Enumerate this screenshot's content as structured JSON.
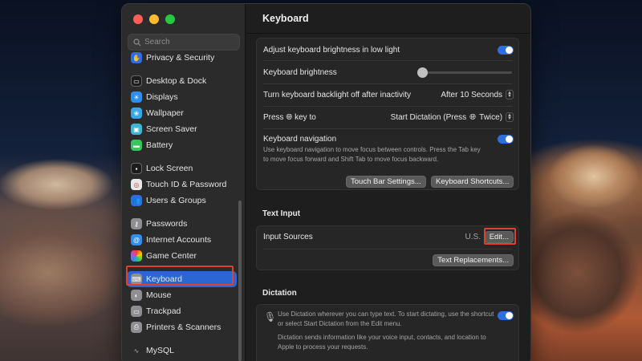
{
  "sidebar": {
    "search_placeholder": "Search",
    "items": [
      {
        "label": "Privacy & Security",
        "icon": "hand-icon",
        "color": "#2f6ee0"
      },
      {
        "label": "Desktop & Dock",
        "icon": "dock-icon",
        "color": "#1c1c1c"
      },
      {
        "label": "Displays",
        "icon": "display-icon",
        "color": "#2f8ff0"
      },
      {
        "label": "Wallpaper",
        "icon": "wallpaper-icon",
        "color": "#36a7e8"
      },
      {
        "label": "Screen Saver",
        "icon": "screensaver-icon",
        "color": "#3db7d8"
      },
      {
        "label": "Battery",
        "icon": "battery-icon",
        "color": "#34c759"
      },
      {
        "label": "Lock Screen",
        "icon": "lock-icon",
        "color": "#1c1c1c"
      },
      {
        "label": "Touch ID & Password",
        "icon": "fingerprint-icon",
        "color": "#e8e8e8"
      },
      {
        "label": "Users & Groups",
        "icon": "users-icon",
        "color": "#2f6ee0"
      },
      {
        "label": "Passwords",
        "icon": "key-icon",
        "color": "#8e8e93"
      },
      {
        "label": "Internet Accounts",
        "icon": "at-icon",
        "color": "#2f8ff0"
      },
      {
        "label": "Game Center",
        "icon": "gamecenter-icon",
        "color": "#e8e8e8"
      },
      {
        "label": "Keyboard",
        "icon": "keyboard-icon",
        "color": "#8e8e93"
      },
      {
        "label": "Mouse",
        "icon": "mouse-icon",
        "color": "#8e8e93"
      },
      {
        "label": "Trackpad",
        "icon": "trackpad-icon",
        "color": "#8e8e93"
      },
      {
        "label": "Printers & Scanners",
        "icon": "printer-icon",
        "color": "#8e8e93"
      },
      {
        "label": "MySQL",
        "icon": "mysql-icon",
        "color": "#2b2b2b"
      }
    ]
  },
  "main": {
    "title": "Keyboard",
    "brightness_low_light_label": "Adjust keyboard brightness in low light",
    "keyboard_brightness_label": "Keyboard brightness",
    "keyboard_brightness_level": 0,
    "backlight_off_label": "Turn keyboard backlight off after inactivity",
    "backlight_off_value": "After 10 Seconds",
    "press_key_label_pre": "Press",
    "press_key_label_post": "key to",
    "press_key_value": "Start Dictation (Press",
    "press_key_value_post": "Twice)",
    "keyboard_nav_label": "Keyboard navigation",
    "keyboard_nav_desc_1": "Use keyboard navigation to move focus between controls. Press the Tab key",
    "keyboard_nav_desc_2": "to move focus forward and Shift Tab to move focus backward.",
    "touch_bar_button": "Touch Bar Settings...",
    "shortcuts_button": "Keyboard Shortcuts...",
    "text_input_heading": "Text Input",
    "input_sources_label": "Input Sources",
    "input_sources_value": "U.S.",
    "edit_button": "Edit...",
    "text_replacements_button": "Text Replacements...",
    "dictation_heading": "Dictation",
    "dictation_desc_1": "Use Dictation wherever you can type text. To start dictating, use the shortcut",
    "dictation_desc_2": "or select Start Dictation from the Edit menu.",
    "dictation_desc_3": "Dictation sends information like your voice input, contacts, and location to",
    "dictation_desc_4": "Apple to process your requests."
  },
  "colors": {
    "accent": "#2d6ee0",
    "highlight": "#e0402f"
  }
}
